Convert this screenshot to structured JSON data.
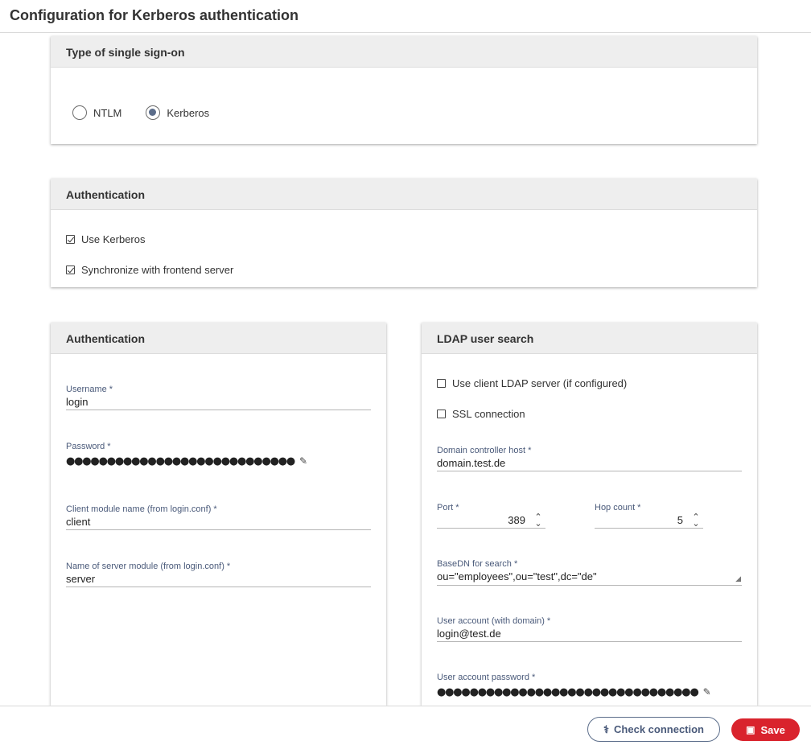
{
  "header": {
    "title": "Configuration for Kerberos authentication"
  },
  "sso_card": {
    "title": "Type of single sign-on",
    "options": [
      {
        "label": "NTLM",
        "checked": false
      },
      {
        "label": "Kerberos",
        "checked": true
      }
    ]
  },
  "auth_card": {
    "title": "Authentication",
    "checks": [
      {
        "label": "Use Kerberos",
        "checked": true
      },
      {
        "label": "Synchronize with frontend server",
        "checked": true
      }
    ]
  },
  "auth_left": {
    "title": "Authentication",
    "username": {
      "label": "Username",
      "required": "*",
      "value": "login"
    },
    "password": {
      "label": "Password",
      "required": "*",
      "masked": "●●●●●●●●●●●●●●●●●●●●●●●●●●●●"
    },
    "client_module": {
      "label": "Client module name (from login.conf)",
      "required": "*",
      "value": "client"
    },
    "server_module": {
      "label": "Name of server module (from login.conf)",
      "required": "*",
      "value": "server"
    }
  },
  "ldap": {
    "title": "LDAP user search",
    "use_client_ldap": {
      "label": "Use client LDAP server (if configured)",
      "checked": false
    },
    "ssl": {
      "label": "SSL connection",
      "checked": false
    },
    "dc_host": {
      "label": "Domain controller host",
      "required": "*",
      "value": "domain.test.de"
    },
    "port": {
      "label": "Port",
      "required": "*",
      "value": "389"
    },
    "hop_count": {
      "label": "Hop count",
      "required": "*",
      "value": "5"
    },
    "basedn": {
      "label": "BaseDN for search",
      "required": "*",
      "value": "ou=\"employees\",ou=\"test\",dc=\"de\""
    },
    "user_account": {
      "label": "User account (with domain)",
      "required": "*",
      "value": "login@test.de"
    },
    "user_password": {
      "label": "User account password",
      "required": "*",
      "masked": "●●●●●●●●●●●●●●●●●●●●●●●●●●●●●●●●"
    }
  },
  "footer": {
    "check_label": "Check connection",
    "save_label": "Save"
  },
  "colors": {
    "accent": "#5b6d8a",
    "save": "#d9232d",
    "label": "#4a5a7a"
  },
  "icons": [
    "pencil-icon",
    "stethoscope-icon",
    "floppy-disk-icon",
    "chevron-up-down-icon",
    "resize-grip-icon"
  ]
}
